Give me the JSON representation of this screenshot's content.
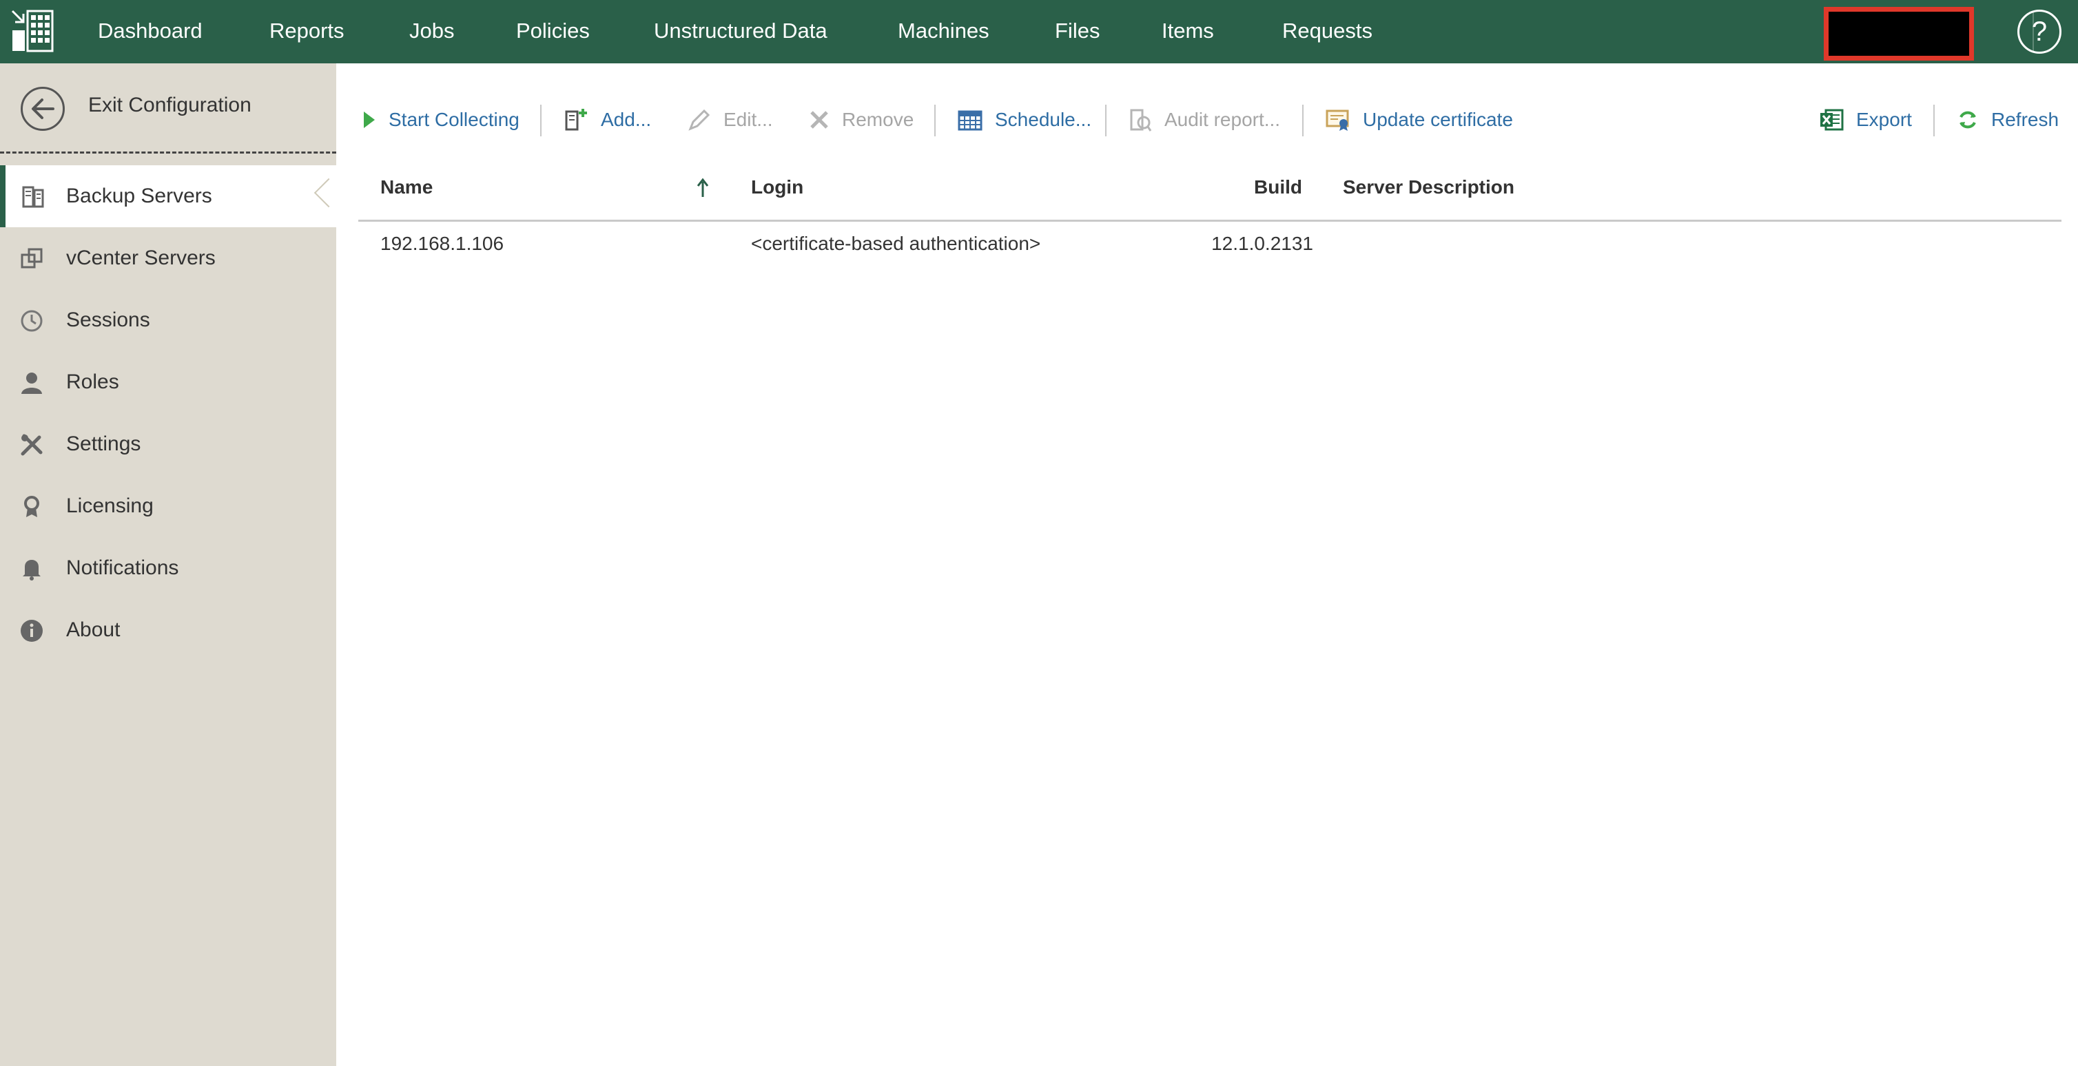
{
  "colors": {
    "topbar_bg": "#2a6049",
    "sidebar_bg": "#dedad0",
    "link_blue": "#2e6da4",
    "disabled_gray": "#a5a5a5",
    "highlight_red": "#e0382a"
  },
  "topnav": {
    "logo_icon": "grid-logo-icon",
    "items": [
      {
        "label": "Dashboard"
      },
      {
        "label": "Reports"
      },
      {
        "label": "Jobs"
      },
      {
        "label": "Policies"
      },
      {
        "label": "Unstructured Data"
      },
      {
        "label": "Machines"
      },
      {
        "label": "Files"
      },
      {
        "label": "Items"
      },
      {
        "label": "Requests"
      }
    ],
    "help_label": "?"
  },
  "sidebar": {
    "exit_label": "Exit Configuration",
    "items": [
      {
        "label": "Backup Servers",
        "icon": "backup-server-icon",
        "active": true
      },
      {
        "label": "vCenter Servers",
        "icon": "vcenter-icon",
        "active": false
      },
      {
        "label": "Sessions",
        "icon": "clock-icon",
        "active": false
      },
      {
        "label": "Roles",
        "icon": "person-icon",
        "active": false
      },
      {
        "label": "Settings",
        "icon": "tools-icon",
        "active": false
      },
      {
        "label": "Licensing",
        "icon": "license-icon",
        "active": false
      },
      {
        "label": "Notifications",
        "icon": "bell-icon",
        "active": false
      },
      {
        "label": "About",
        "icon": "info-icon",
        "active": false
      }
    ]
  },
  "toolbar": {
    "start_collecting": "Start Collecting",
    "add": "Add...",
    "edit": "Edit...",
    "remove": "Remove",
    "schedule": "Schedule...",
    "audit_report": "Audit report...",
    "update_certificate": "Update certificate",
    "export": "Export",
    "refresh": "Refresh"
  },
  "grid": {
    "columns": {
      "name": "Name",
      "login": "Login",
      "build": "Build",
      "description": "Server Description"
    },
    "sort": {
      "column": "name",
      "direction": "ascending"
    },
    "rows": [
      {
        "name": "192.168.1.106",
        "login": "<certificate-based authentication>",
        "build": "12.1.0.2131",
        "description": ""
      }
    ]
  }
}
